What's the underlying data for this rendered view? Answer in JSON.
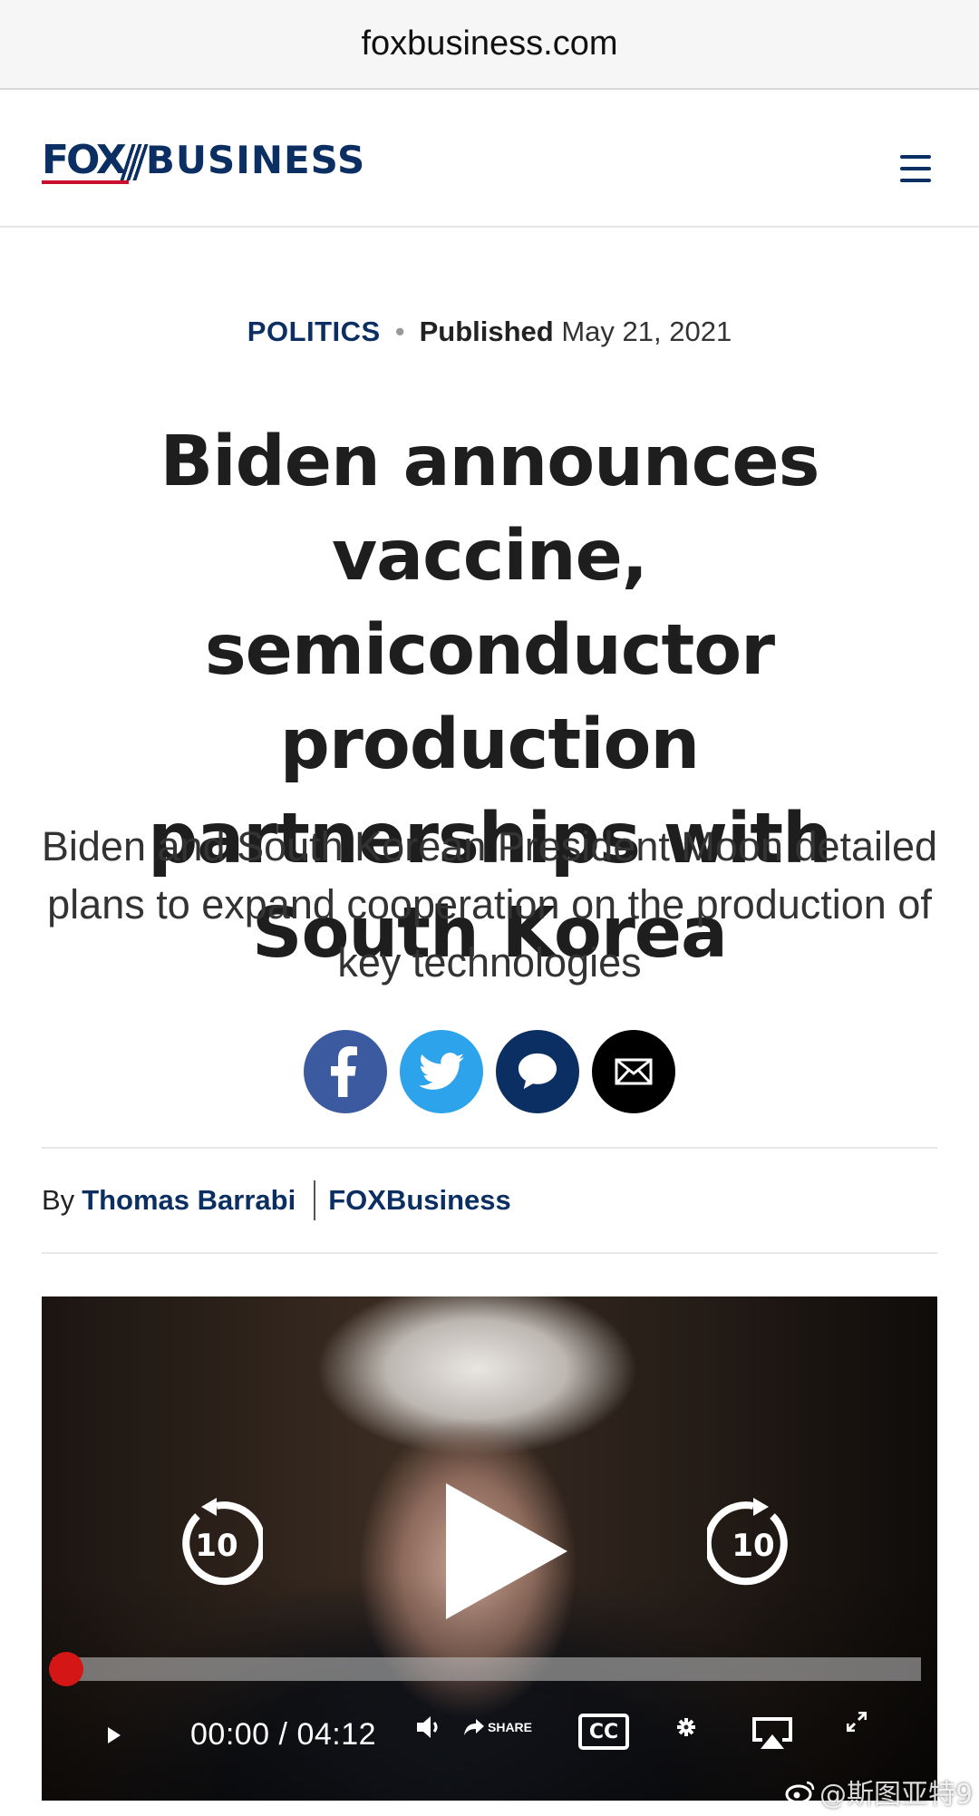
{
  "browser": {
    "url": "foxbusiness.com"
  },
  "header": {
    "logo_fox": "FOX",
    "logo_business": "BUSINESS",
    "menu_icon": "hamburger-menu-icon"
  },
  "article": {
    "category": "POLITICS",
    "published_label": "Published",
    "published_date": "May 21, 2021",
    "headline": "Biden announces vaccine, semiconductor production partnerships with South Korea",
    "subheadline": "Biden and South Korean President Moon detailed plans to expand cooperation on the production of key technologies",
    "share_buttons": [
      {
        "name": "facebook",
        "icon": "facebook-icon",
        "color": "#3b5aa0"
      },
      {
        "name": "twitter",
        "icon": "twitter-icon",
        "color": "#2ca3ea"
      },
      {
        "name": "comments",
        "icon": "comment-icon",
        "color": "#0b2f63"
      },
      {
        "name": "email",
        "icon": "email-icon",
        "color": "#000000"
      }
    ],
    "byline": {
      "by": "By",
      "author": "Thomas Barrabi",
      "source": "FOXBusiness"
    }
  },
  "video": {
    "skip_back_seconds": "10",
    "skip_forward_seconds": "10",
    "progress": 0,
    "current_time": "00:00",
    "separator": "/",
    "duration": "04:12",
    "share_label": "SHARE",
    "cc_label": "CC",
    "progress_color": "#d51616"
  },
  "watermark": {
    "text": "@斯图亚特9"
  }
}
